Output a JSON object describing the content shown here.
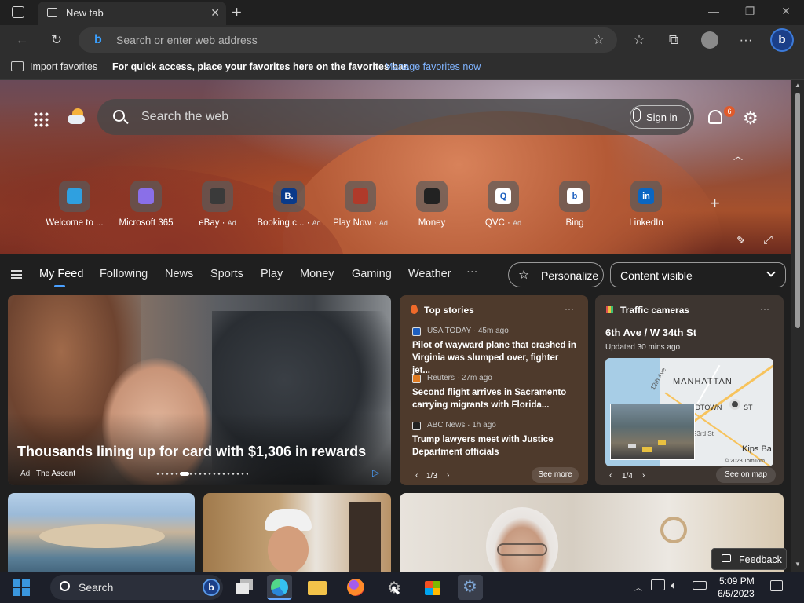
{
  "browser": {
    "tab_title": "New tab",
    "address_placeholder": "Search or enter web address"
  },
  "favorites_bar": {
    "import_label": "Import favorites",
    "hint": "For quick access, place your favorites here on the favorites bar.",
    "manage_link": "Manage favorites now"
  },
  "hero": {
    "search_placeholder": "Search the web",
    "sign_in": "Sign in",
    "notification_count": "6",
    "quick_links": [
      {
        "label": "Welcome to ...",
        "ad": "",
        "icon": "edge-icon",
        "color": "#2fa0e0",
        "glyph": ""
      },
      {
        "label": "Microsoft 365",
        "ad": "",
        "icon": "microsoft365-icon",
        "color": "#8a6fe8",
        "glyph": ""
      },
      {
        "label": "eBay",
        "ad": "Ad",
        "icon": "ebay-icon",
        "color": "#3a3a3a",
        "glyph": ""
      },
      {
        "label": "Booking.c...",
        "ad": "Ad",
        "icon": "booking-icon",
        "color": "#0a3a8a",
        "glyph": "B."
      },
      {
        "label": "Play Now",
        "ad": "Ad",
        "icon": "play-now-icon",
        "color": "#b03a2a",
        "glyph": ""
      },
      {
        "label": "Money",
        "ad": "",
        "icon": "money-icon",
        "color": "#222222",
        "glyph": ""
      },
      {
        "label": "QVC",
        "ad": "Ad",
        "icon": "qvc-icon",
        "color": "#ffffff",
        "glyph": "Q"
      },
      {
        "label": "Bing",
        "ad": "",
        "icon": "bing-icon",
        "color": "#ffffff",
        "glyph": "b"
      },
      {
        "label": "LinkedIn",
        "ad": "",
        "icon": "linkedin-icon",
        "color": "#0a66c2",
        "glyph": "in"
      }
    ]
  },
  "feed_nav": {
    "items": [
      "My Feed",
      "Following",
      "News",
      "Sports",
      "Play",
      "Money",
      "Gaming",
      "Weather"
    ],
    "more": "···",
    "personalize": "Personalize",
    "content_visible": "Content visible"
  },
  "promo_card": {
    "headline": "Thousands lining up for card with $1,306 in rewards",
    "ad_label": "Ad",
    "source": "The Ascent"
  },
  "top_stories": {
    "title": "Top stories",
    "more": "···",
    "pager": "1/3",
    "see_more": "See more",
    "items": [
      {
        "source": "USA TODAY · 45m ago",
        "headline": "Pilot of wayward plane that crashed in Virginia was slumped over, fighter jet...",
        "color": "#1e5fbf"
      },
      {
        "source": "Reuters · 27m ago",
        "headline": "Second flight arrives in Sacramento carrying migrants with Florida...",
        "color": "#e07a20"
      },
      {
        "source": "ABC News · 1h ago",
        "headline": "Trump lawyers meet with Justice Department officials",
        "color": "#222222"
      }
    ]
  },
  "traffic": {
    "title": "Traffic cameras",
    "more": "···",
    "location": "6th Ave / W 34th St",
    "updated": "Updated 30 mins ago",
    "pager": "1/4",
    "see_on_map": "See on map",
    "map_labels": {
      "manhattan": "MANHATTAN",
      "st12": "12th Ave",
      "midtown": "IDTOWN",
      "east": "ST",
      "rd23": "23rd St",
      "kips": "Kips Ba",
      "copyright": "© 2023 TomTom"
    }
  },
  "feedback": "Feedback",
  "taskbar": {
    "search_label": "Search",
    "time": "5:09 PM",
    "date": "6/5/2023"
  }
}
